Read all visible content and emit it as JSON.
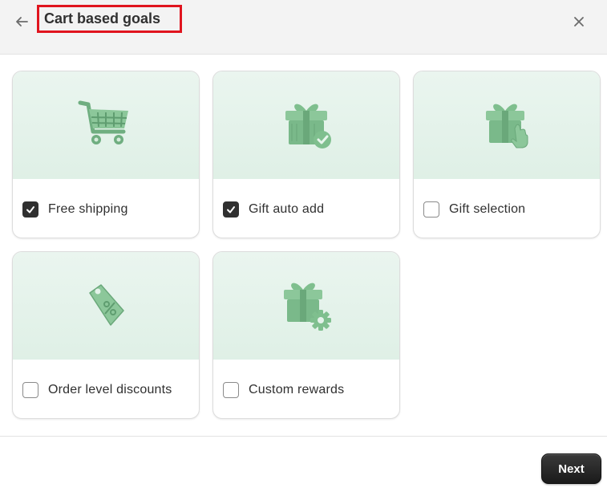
{
  "header": {
    "title": "Cart based goals",
    "back_icon": "arrow-left-icon",
    "close_icon": "close-icon"
  },
  "cards": [
    {
      "label": "Free shipping",
      "checked": true,
      "icon": "shopping-cart-icon"
    },
    {
      "label": "Gift auto add",
      "checked": true,
      "icon": "gift-check-icon"
    },
    {
      "label": "Gift selection",
      "checked": false,
      "icon": "gift-hand-icon"
    },
    {
      "label": "Order level discounts",
      "checked": false,
      "icon": "discount-tag-icon"
    },
    {
      "label": "Custom rewards",
      "checked": false,
      "icon": "gift-gear-icon"
    }
  ],
  "footer": {
    "next_label": "Next"
  },
  "colors": {
    "accent": "#303030",
    "highlight_border": "#e0141e",
    "illustration_green": "#7fbf8e",
    "card_bg": "#e4f2ea"
  }
}
